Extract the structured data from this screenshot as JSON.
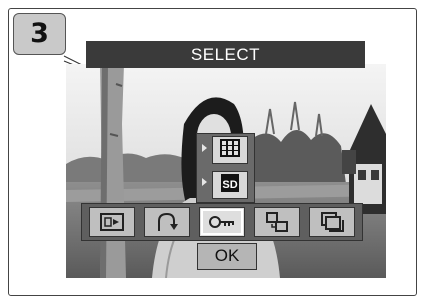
{
  "step_number": "3",
  "screen": {
    "title": "SELECT",
    "ok_label": "OK",
    "submenu": {
      "items": [
        {
          "icon": "grid-icon"
        },
        {
          "icon": "sd-card-icon",
          "label": "SD"
        }
      ]
    },
    "icon_bar": [
      {
        "icon": "slideshow-icon"
      },
      {
        "icon": "rotate-icon"
      },
      {
        "icon": "protect-key-icon",
        "label": "O-m"
      },
      {
        "icon": "copy-icon"
      },
      {
        "icon": "print-order-icon"
      }
    ]
  }
}
